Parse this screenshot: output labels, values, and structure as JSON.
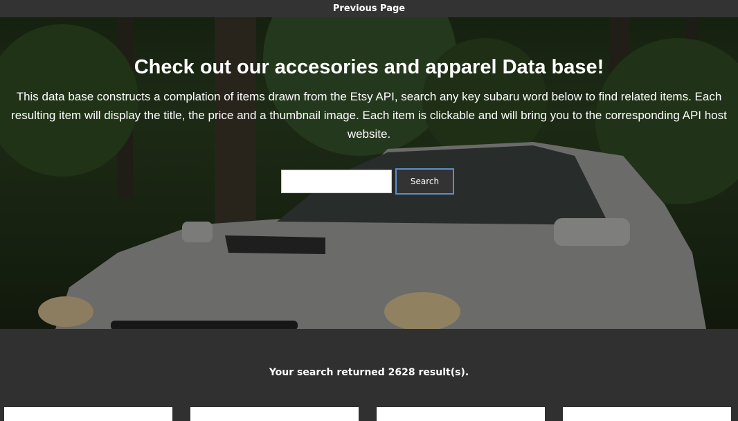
{
  "nav": {
    "previous_label": "Previous Page"
  },
  "hero": {
    "title": "Check out our accesories and apparel Data base!",
    "description": "This data base constructs a complation of items drawn from the Etsy API, search any key subaru word below to find related items. Each resulting item will display the title, the price and a thumbnail image. Each item is clickable and will bring you to the corresponding API host website.",
    "background_image": "white-subaru-in-forest"
  },
  "search": {
    "input_value": "",
    "button_label": "Search"
  },
  "results": {
    "summary": "Your search returned 2628 result(s).",
    "cards": [
      {},
      {},
      {},
      {}
    ]
  },
  "colors": {
    "page_background": "#303030",
    "topbar": "#333333",
    "button": "#333333",
    "button_focus_border": "#5b8fc6"
  }
}
